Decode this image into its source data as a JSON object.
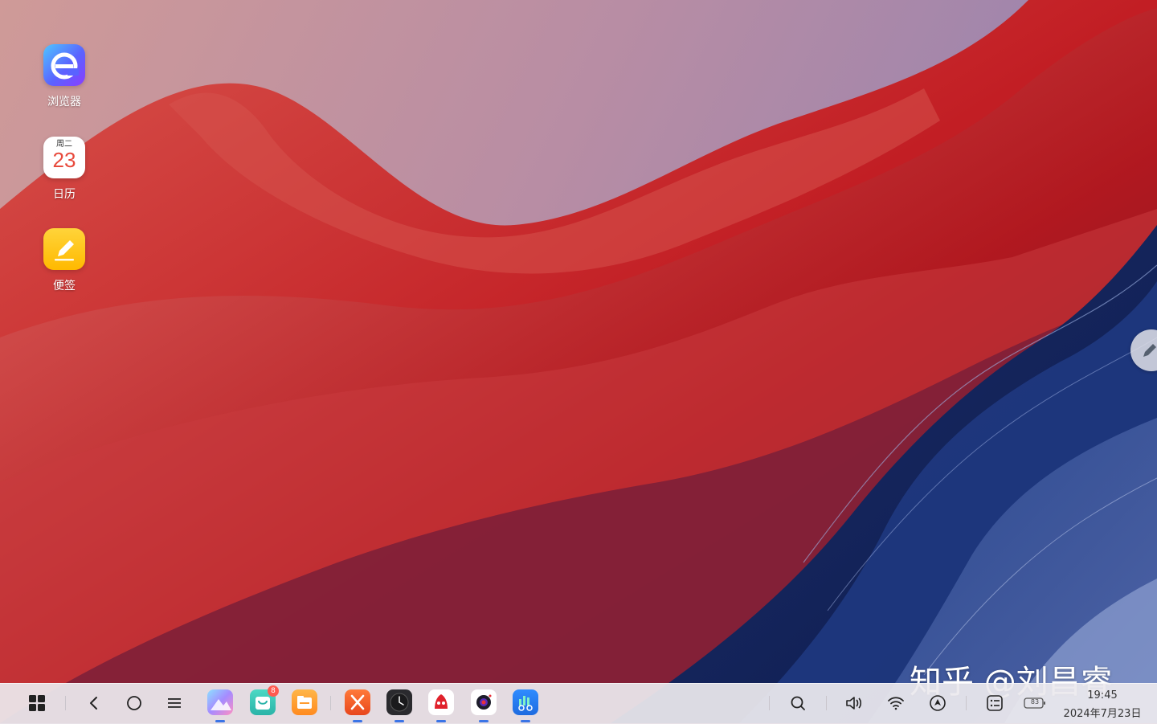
{
  "desktop": {
    "icons": [
      {
        "label": "浏览器",
        "icon": "browser-icon"
      },
      {
        "label": "日历",
        "icon": "calendar-icon",
        "weekday": "周二",
        "day": "23"
      },
      {
        "label": "便签",
        "icon": "notes-icon"
      }
    ]
  },
  "watermark": "知乎 @刘昌睿",
  "taskbar": {
    "nav": [
      "start-icon",
      "back-icon",
      "home-icon",
      "menu-icon"
    ],
    "apps": [
      {
        "name": "gallery",
        "icon": "gallery-icon",
        "running": true
      },
      {
        "name": "app-store",
        "icon": "store-icon",
        "running": false,
        "badge": "8"
      },
      {
        "name": "files",
        "icon": "folder-icon",
        "running": false
      },
      {
        "name": "slides",
        "icon": "slides-icon",
        "running": true
      },
      {
        "name": "clock",
        "icon": "clock-icon",
        "running": true
      },
      {
        "name": "antutu",
        "icon": "antutu-icon",
        "running": true
      },
      {
        "name": "camera",
        "icon": "camera-icon",
        "running": true
      },
      {
        "name": "benchmark",
        "icon": "benchmark-icon",
        "running": true
      }
    ],
    "tray": {
      "icons": [
        "search-icon",
        "volume-icon",
        "wifi-icon",
        "navigation-icon",
        "notifications-icon",
        "battery-icon"
      ],
      "battery": "83",
      "time": "19:45",
      "date": "2024年7月23日"
    }
  },
  "colors": {
    "taskbar_bg": "#ece9ee",
    "accent": "#3b74e6",
    "badge": "#ff5a4f"
  }
}
